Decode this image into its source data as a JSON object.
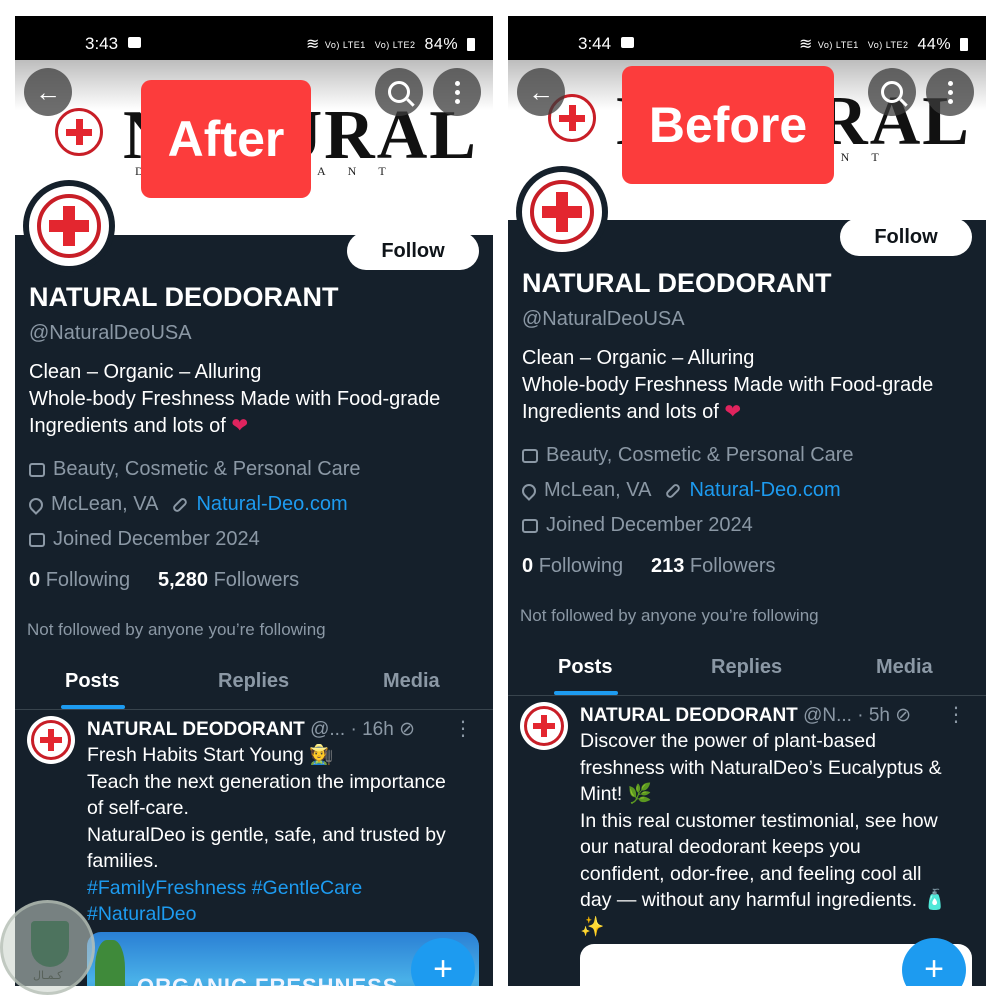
{
  "left": {
    "status": {
      "time": "3:43",
      "net1": "Vo) LTE1",
      "net2": "Vo) LTE2",
      "battery": "84%"
    },
    "tag": "After",
    "banner_word": "NATURAL",
    "banner_sub": "DEODORANT",
    "follow_label": "Follow",
    "name": "NATURAL DEODORANT",
    "handle": "@NaturalDeoUSA",
    "bio": [
      "Clean – Organic – Alluring",
      "Whole-body Freshness Made with Food-grade",
      "Ingredients and lots of"
    ],
    "category": "Beauty, Cosmetic & Personal Care",
    "location": "McLean, VA",
    "website": "Natural-Deo.com",
    "joined": "Joined December 2024",
    "following_count": "0",
    "following_label": "Following",
    "followers_count": "5,280",
    "followers_label": "Followers",
    "not_followed": "Not followed by anyone you’re following",
    "tabs": [
      "Posts",
      "Replies",
      "Media"
    ],
    "post": {
      "author": "NATURAL DEODORANT",
      "handle": "@...",
      "time": "· 16h",
      "lines": [
        "Fresh Habits Start Young 🧑‍🌾",
        "Teach the next generation the importance",
        "of self-care.",
        "NaturalDeo is gentle, safe, and trusted by",
        "families."
      ],
      "hashtags": [
        "#FamilyFreshness #GentleCare",
        "#NaturalDeo"
      ],
      "media_text": "ORGANIC FRESHNESS"
    },
    "fab": "+"
  },
  "right": {
    "status": {
      "time": "3:44",
      "net1": "Vo) LTE1",
      "net2": "Vo) LTE2",
      "battery": "44%"
    },
    "tag": "Before",
    "banner_word": "NATURAL",
    "banner_sub": "DEODORANT",
    "follow_label": "Follow",
    "name": "NATURAL DEODORANT",
    "handle": "@NaturalDeoUSA",
    "bio": [
      "Clean – Organic – Alluring",
      "Whole-body Freshness Made with Food-grade",
      "Ingredients and lots of"
    ],
    "category": "Beauty, Cosmetic & Personal Care",
    "location": "McLean, VA",
    "website": "Natural-Deo.com",
    "joined": "Joined December 2024",
    "following_count": "0",
    "following_label": "Following",
    "followers_count": "213",
    "followers_label": "Followers",
    "not_followed": "Not followed by anyone you’re following",
    "tabs": [
      "Posts",
      "Replies",
      "Media"
    ],
    "post": {
      "author": "NATURAL DEODORANT",
      "handle": "@N...",
      "time": "· 5h",
      "lines": [
        "Discover the power of plant-based",
        "freshness with NaturalDeo’s Eucalyptus &",
        "Mint! 🌿",
        "In this real customer testimonial, see how",
        "our natural deodorant keeps you",
        "confident, odor-free, and feeling cool all",
        "day — without any harmful ingredients. 🧴",
        "✨"
      ]
    },
    "fab": "+"
  },
  "colors": {
    "background": "#15202b",
    "accent": "#1d9bf0",
    "tag": "#fc3c3c",
    "muted": "#8b98a5"
  }
}
